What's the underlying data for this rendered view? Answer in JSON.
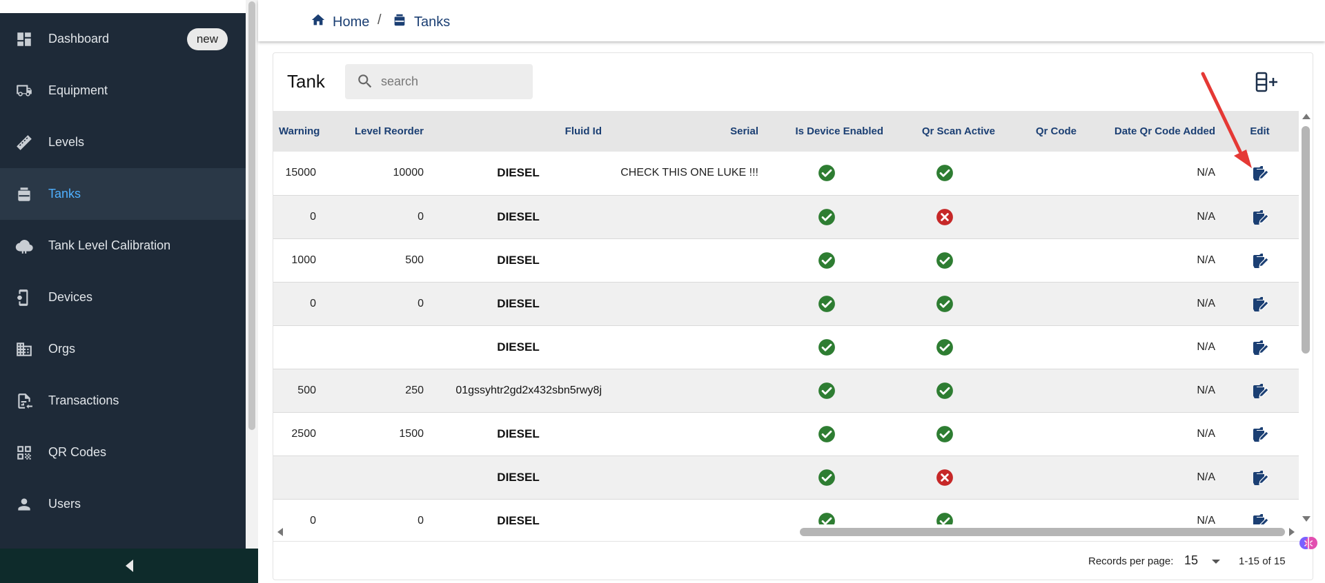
{
  "sidebar": {
    "items": [
      {
        "label": "Dashboard",
        "icon": "dashboard-icon",
        "badge": "new"
      },
      {
        "label": "Equipment",
        "icon": "truck-icon"
      },
      {
        "label": "Levels",
        "icon": "ruler-icon"
      },
      {
        "label": "Tanks",
        "icon": "tank-icon",
        "active": true
      },
      {
        "label": "Tank Level Calibration",
        "icon": "cloud-icon"
      },
      {
        "label": "Devices",
        "icon": "device-icon"
      },
      {
        "label": "Orgs",
        "icon": "building-icon"
      },
      {
        "label": "Transactions",
        "icon": "document-icon"
      },
      {
        "label": "QR Codes",
        "icon": "qr-icon"
      },
      {
        "label": "Users",
        "icon": "person-icon"
      }
    ]
  },
  "breadcrumb": {
    "home": "Home",
    "separator": "/",
    "current": "Tanks"
  },
  "card": {
    "title": "Tank",
    "search_placeholder": "search"
  },
  "table": {
    "columns": [
      "Warning",
      "Level Reorder",
      "Fluid Id",
      "Serial",
      "Is Device Enabled",
      "Qr Scan Active",
      "Qr Code",
      "Date Qr Code Added",
      "Edit"
    ],
    "rows": [
      {
        "warning": "15000",
        "reorder": "10000",
        "fluid": "DIESEL",
        "serial": "CHECK THIS ONE LUKE !!!",
        "enabled": true,
        "qr_active": true,
        "qr_code": "",
        "date_added": "N/A"
      },
      {
        "warning": "0",
        "reorder": "0",
        "fluid": "DIESEL",
        "serial": "",
        "enabled": true,
        "qr_active": false,
        "qr_code": "",
        "date_added": "N/A"
      },
      {
        "warning": "1000",
        "reorder": "500",
        "fluid": "DIESEL",
        "serial": "",
        "enabled": true,
        "qr_active": true,
        "qr_code": "",
        "date_added": "N/A"
      },
      {
        "warning": "0",
        "reorder": "0",
        "fluid": "DIESEL",
        "serial": "",
        "enabled": true,
        "qr_active": true,
        "qr_code": "",
        "date_added": "N/A"
      },
      {
        "warning": "",
        "reorder": "",
        "fluid": "DIESEL",
        "serial": "",
        "enabled": true,
        "qr_active": true,
        "qr_code": "",
        "date_added": "N/A"
      },
      {
        "warning": "500",
        "reorder": "250",
        "fluid": "01gssyhtr2gd2x432sbn5rwy8j",
        "serial": "",
        "enabled": true,
        "qr_active": true,
        "qr_code": "",
        "date_added": "N/A",
        "fluid_long": true
      },
      {
        "warning": "2500",
        "reorder": "1500",
        "fluid": "DIESEL",
        "serial": "",
        "enabled": true,
        "qr_active": true,
        "qr_code": "",
        "date_added": "N/A"
      },
      {
        "warning": "",
        "reorder": "",
        "fluid": "DIESEL",
        "serial": "",
        "enabled": true,
        "qr_active": false,
        "qr_code": "",
        "date_added": "N/A"
      },
      {
        "warning": "0",
        "reorder": "0",
        "fluid": "DIESEL",
        "serial": "",
        "enabled": true,
        "qr_active": true,
        "qr_code": "",
        "date_added": "N/A"
      }
    ]
  },
  "footer": {
    "records_per_page_label": "Records per page:",
    "records_per_page_value": "15",
    "range": "1-15 of 15"
  },
  "colors": {
    "sidebar_bg": "#1e2a38",
    "accent_blue": "#1b3f73",
    "active_text": "#4fb0ff",
    "check_green": "#2e7d32",
    "cross_red": "#c62828",
    "annotation_arrow": "#e53935"
  }
}
